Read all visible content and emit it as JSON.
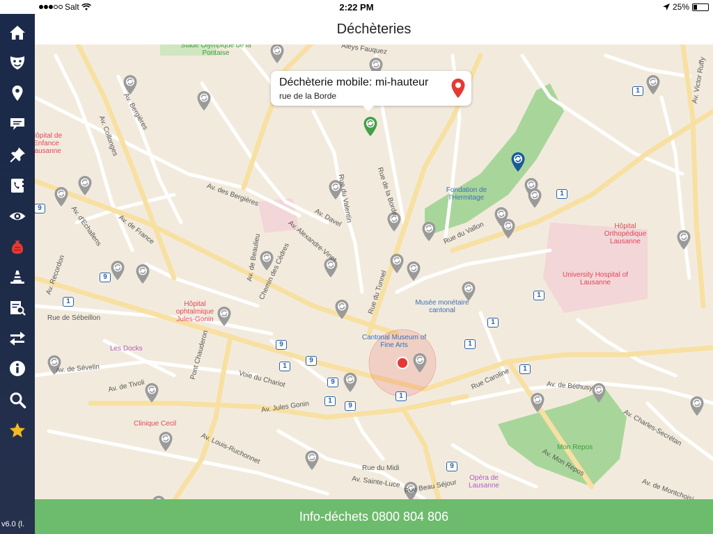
{
  "status": {
    "carrier": "Salt",
    "time": "2:22 PM",
    "battery": "25%",
    "battery_level": 0.25
  },
  "header": {
    "title": "Déchèteries"
  },
  "sidebar": {
    "items": [
      {
        "icon": "home-icon"
      },
      {
        "icon": "theater-mask-icon"
      },
      {
        "icon": "map-marker-icon"
      },
      {
        "icon": "speech-bubble-icon"
      },
      {
        "icon": "pin-icon"
      },
      {
        "icon": "phone-book-icon"
      },
      {
        "icon": "eye-icon"
      },
      {
        "icon": "trash-bag-icon"
      },
      {
        "icon": "traffic-cone-icon"
      },
      {
        "icon": "document-search-icon"
      },
      {
        "icon": "arrows-exchange-icon"
      },
      {
        "icon": "info-icon"
      },
      {
        "icon": "search-icon"
      },
      {
        "icon": "star-icon"
      }
    ],
    "version": "v6.0 (l."
  },
  "callout": {
    "name": "Déchèterie mobile: mi-hauteur",
    "street": "rue de la Borde"
  },
  "footer": {
    "label": "Info-déchets 0800 804 806"
  },
  "map": {
    "streets": [
      "Av. des Bergières",
      "Av. de France",
      "Rue du Valentin",
      "Rue de la Borde",
      "Av. Davel",
      "Av. Alexandre-Vinet",
      "Rue du Tunnel",
      "Rue de Sébeillon",
      "Av. de Sévelin",
      "Av. de Tivoli",
      "Pont Chauderon",
      "Voie du Chariot",
      "Av. Jules Gonin",
      "Av. Louis-Ruchonnet",
      "Rue du Vallon",
      "Rue Caroline",
      "Av. de Béthusy",
      "Av. Mon Repos",
      "Av. Victor Ruffy",
      "Av. Charles-Secrétan",
      "Rue du Midi",
      "Av. Sainte-Luce",
      "Rue Beau Séjour",
      "Av. Recordon",
      "Av. d'Echallens",
      "Av. Collonges",
      "Av. Bergières",
      "Chemin des Cèdres",
      "Av. de Beaulieu",
      "Aleys Fauquez",
      "Av. de Montchoisi"
    ],
    "pois": [
      {
        "name": "Stade Olympique de la Pontaise",
        "color": "#3e9a3e"
      },
      {
        "name": "Fondation de l'Hermitage",
        "color": "#3d6fb0"
      },
      {
        "name": "Hôpital Orthopédique Lausanne",
        "color": "#e0465a"
      },
      {
        "name": "University Hospital of Lausanne",
        "color": "#e0465a"
      },
      {
        "name": "Hôpital ophtalmique Jules-Gonin",
        "color": "#e0465a"
      },
      {
        "name": "Musée monétaire cantonal",
        "color": "#3d6fb0"
      },
      {
        "name": "Cantonal Museum of Fine Arts",
        "color": "#3d6fb0"
      },
      {
        "name": "Les Docks",
        "color": "#b05cc0"
      },
      {
        "name": "Clinique Cecil",
        "color": "#e0465a"
      },
      {
        "name": "Mon Repos",
        "color": "#3e9a3e"
      },
      {
        "name": "Opéra de Lausanne",
        "color": "#b05cc0"
      },
      {
        "name": "Hôpital de l'Enfance Lausanne",
        "color": "#e0465a"
      }
    ],
    "bus_badges": [
      "1",
      "9"
    ],
    "colors": {
      "road": "#ffffff",
      "main_road": "#f8e0a2",
      "park": "#a8d69a",
      "hospital_area": "#f3d6d8",
      "recycling_marker": "#9a9a9a",
      "selected_marker": "#43a047",
      "blue_marker": "#1a5a9a",
      "callout_pin": "#e53935",
      "footer": "#6dbb6c",
      "sidebar": "#1d2b48",
      "user_location": "#e53935"
    }
  }
}
